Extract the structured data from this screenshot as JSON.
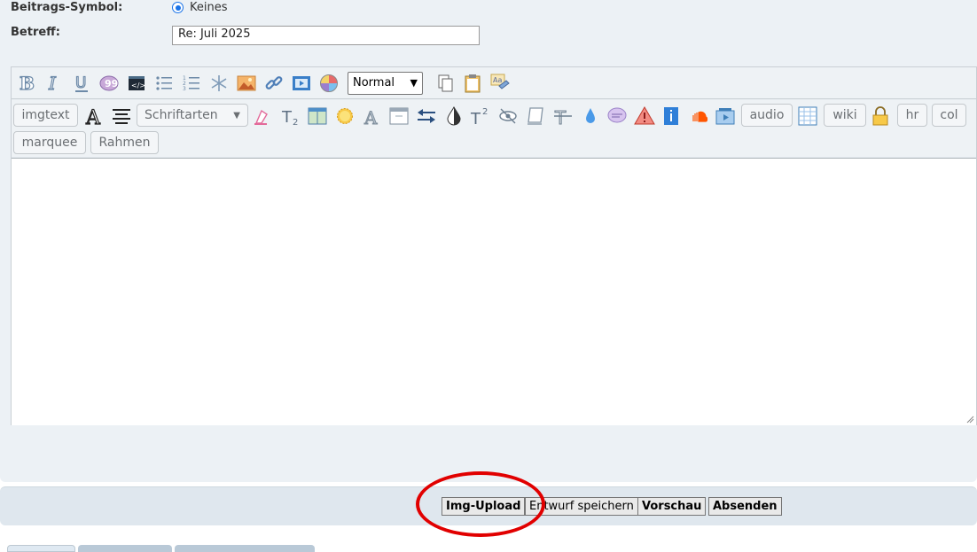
{
  "form": {
    "symbol_label": "Beitrags-Symbol:",
    "symbol_option": "Keines",
    "subject_label": "Betreff:",
    "subject_value": "Re: Juli 2025"
  },
  "toolbar": {
    "row1_icons": [
      "bold-icon",
      "italic-icon",
      "underline-icon",
      "quote-icon",
      "code-icon",
      "bullet-list-icon",
      "numbered-list-icon",
      "list-item-star-icon",
      "image-icon",
      "link-icon",
      "video-icon",
      "color-wheel-icon"
    ],
    "format_select": "Normal",
    "row1_icons_after": [
      "copy-icon",
      "paste-icon",
      "spellcheck-icon"
    ],
    "chips": {
      "imgtext": "imgtext",
      "schriftarten": "Schriftarten",
      "audio": "audio",
      "wiki": "wiki",
      "hr": "hr",
      "col": "col",
      "marquee": "marquee",
      "rahmen": "Rahmen"
    }
  },
  "buttons": {
    "img_upload": "Img-Upload",
    "save_draft": "Entwurf speichern",
    "preview": "Vorschau",
    "submit": "Absenden"
  },
  "annotation_color": "#e10000"
}
